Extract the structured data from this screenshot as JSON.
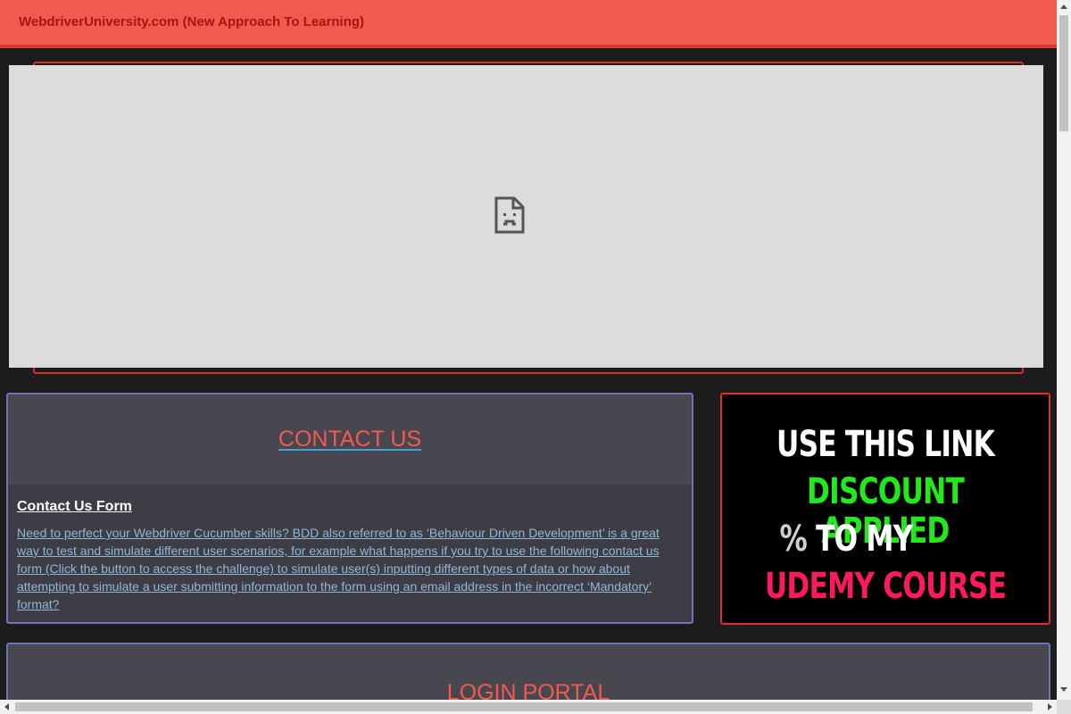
{
  "navbar": {
    "brand": "WebdriverUniversity.com (New Approach To Learning)"
  },
  "contact": {
    "title": "CONTACT US",
    "subtitle": "Contact Us Form",
    "description": "Need to perfect your Webdriver Cucumber skills? BDD also referred to as ‘Behaviour Driven Development’ is a great way to test and simulate different user scenarios, for example what happens if you try to use the following contact us form (Click the button to access the challenge) to simulate user(s) inputting different types of data or how about attempting to simulate a user submitting information to the form using an email address in the incorrect ‘Mandatory’ format?"
  },
  "promo": {
    "line1": "USE THIS LINK",
    "line2": "DISCOUNT APPLIED",
    "line3_symbol": "%",
    "line3_text": " TO MY",
    "line4": "UDEMY COURSE",
    "colors": {
      "line1": "#ffffff",
      "line2": "#22e81c",
      "line3_symbol": "#cfcfcf",
      "line3_text": "#ffffff",
      "line4": "#ff1a5e"
    }
  },
  "login": {
    "title": "LOGIN PORTAL"
  },
  "icons": {
    "broken_frame": "broken-document-icon"
  },
  "colors": {
    "accent": "#f35a4f",
    "card_border": "#6f74b8",
    "promo_border": "#e0302c"
  }
}
